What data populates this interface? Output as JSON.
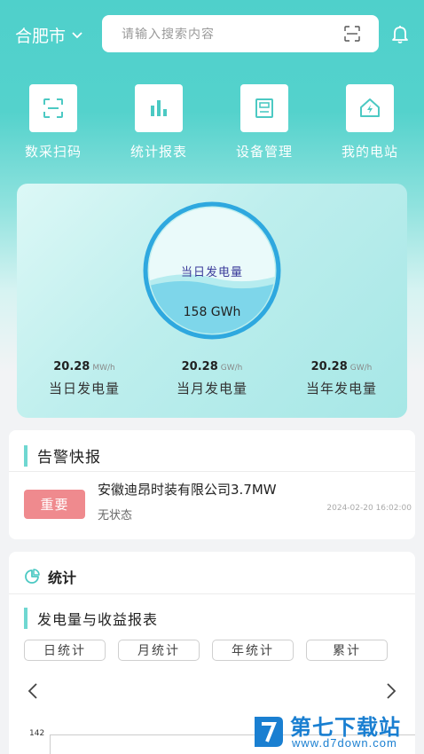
{
  "header": {
    "city": "合肥市",
    "search_placeholder": "请输入搜索内容"
  },
  "quick_actions": [
    {
      "label": "数采扫码",
      "icon": "scan-icon"
    },
    {
      "label": "统计报表",
      "icon": "bar-chart-icon"
    },
    {
      "label": "设备管理",
      "icon": "device-icon"
    },
    {
      "label": "我的电站",
      "icon": "station-home-icon"
    }
  ],
  "power": {
    "gauge_title": "当日发电量",
    "gauge_value": "158 GWh",
    "stats": [
      {
        "value": "20.28",
        "unit": "MW/h",
        "label": "当日发电量"
      },
      {
        "value": "20.28",
        "unit": "GW/h",
        "label": "当月发电量"
      },
      {
        "value": "20.28",
        "unit": "GW/h",
        "label": "当年发电量"
      }
    ]
  },
  "alarm": {
    "title": "告警快报",
    "level": "重要",
    "company": "安徽迪昂时装有限公司3.7MW",
    "status": "无状态",
    "time": "2024-02-20 16:02:00"
  },
  "statistics": {
    "title": "统计",
    "report_title": "发电量与收益报表",
    "tabs": [
      "日统计",
      "月统计",
      "年统计",
      "累计"
    ],
    "y_top_tick": "142"
  },
  "watermark": {
    "name": "第七下载站",
    "url": "www.d7down.com"
  },
  "colors": {
    "accent": "#54d2cc",
    "badge": "#ef8a8e",
    "gauge_ring": "#3aaee0"
  }
}
